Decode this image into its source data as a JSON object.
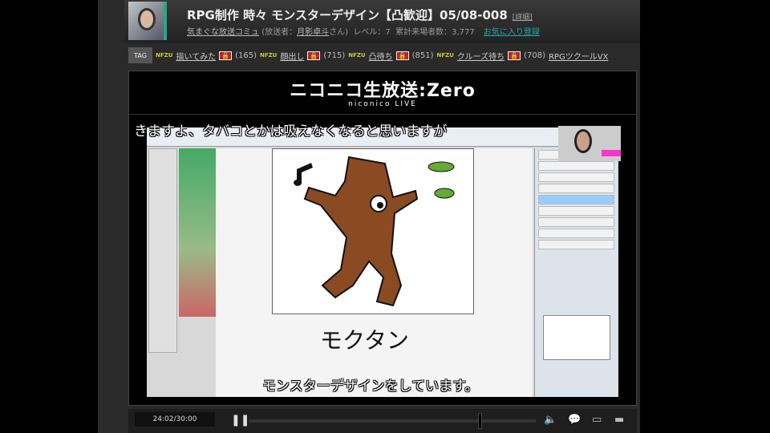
{
  "header": {
    "title": "RPG制作 時々 モンスターデザイン【凸歓迎】05/08-008",
    "detail": "[詳細]",
    "community": "気まぐな放送コミュ",
    "broadcaster_prefix": "(放送者：",
    "broadcaster": "月影卓斗",
    "broadcaster_suffix": "さん)",
    "level": "レベル：7",
    "visitors": "累計来場者数：3,777",
    "favorite": "お気に入り登録"
  },
  "tags": {
    "label": "TAG",
    "items": [
      {
        "badge": "NFZU",
        "name": "描いてみた",
        "lock": "🔒",
        "count": "(165)"
      },
      {
        "badge": "NFZU",
        "name": "顔出し",
        "lock": "🔒",
        "count": "(715)"
      },
      {
        "badge": "NFZU",
        "name": "凸待ち",
        "lock": "🔒",
        "count": "(851)"
      },
      {
        "badge": "NFZU",
        "name": "クルーズ待ち",
        "lock": "🔒",
        "count": "(708)"
      }
    ],
    "last": "RPGツクールVX"
  },
  "banner": {
    "logo": "ニコニコ生放送:Zero",
    "sub": "niconico LIVE"
  },
  "video": {
    "comment_top": "きますよ、タバコとかは吸えなくなると思いますが",
    "character_name": "モクタン",
    "comment_bottom": "モンスターデザインをしています。"
  },
  "controls": {
    "time": "24:02/30:00",
    "progress": 0.8,
    "pause": "❚❚",
    "volume": "🔈",
    "comment": "💬",
    "screen1": "▭",
    "screen2": "▬"
  }
}
